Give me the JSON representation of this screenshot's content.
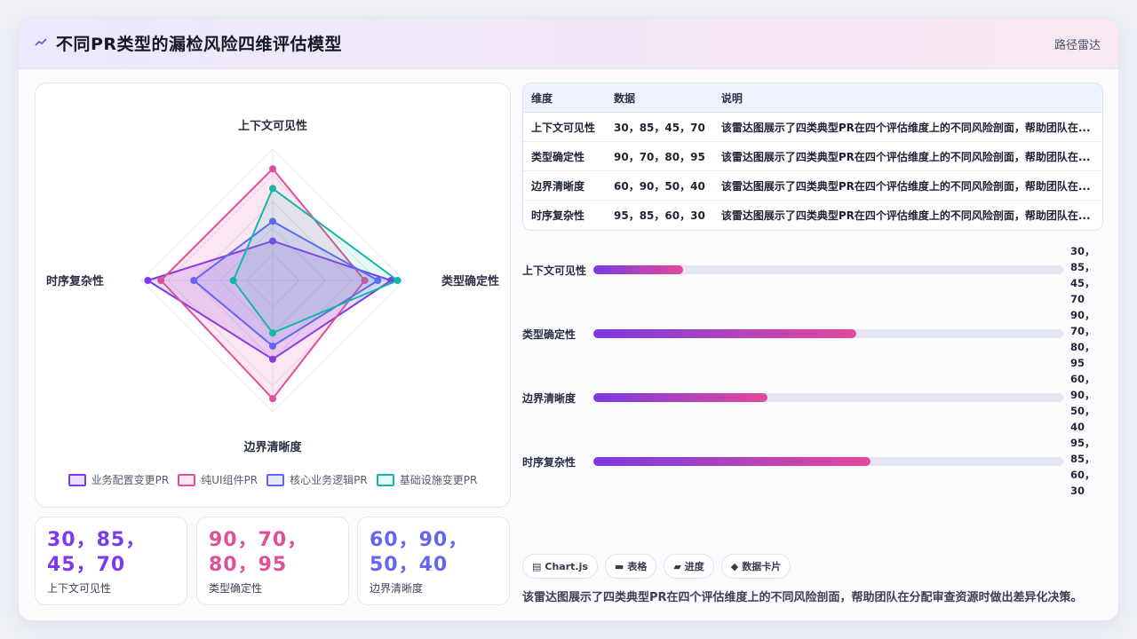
{
  "header": {
    "title": "不同PR类型的漏检风险四维评估模型",
    "tag": "路径雷达"
  },
  "colors": {
    "series_1": "#7c3aed",
    "series_2": "#e0509a",
    "series_3": "#6366f1",
    "series_4": "#14b8a6"
  },
  "chart_data": {
    "type": "radar",
    "axes": [
      "上下文可见性",
      "类型确定性",
      "边界清晰度",
      "时序复杂性"
    ],
    "range": [
      0,
      100
    ],
    "grid": true,
    "legend_position": "bottom",
    "series": [
      {
        "name": "业务配置变更PR",
        "values": [
          30,
          90,
          60,
          95
        ]
      },
      {
        "name": "纯UI组件PR",
        "values": [
          85,
          70,
          90,
          85
        ]
      },
      {
        "name": "核心业务逻辑PR",
        "values": [
          45,
          80,
          50,
          60
        ]
      },
      {
        "name": "基础设施变更PR",
        "values": [
          70,
          95,
          40,
          30
        ]
      }
    ]
  },
  "table": {
    "headers": [
      "维度",
      "数据",
      "说明"
    ],
    "rows": [
      {
        "dim": "上下文可见性",
        "data": "30，85，45，70",
        "desc": "该雷达图展示了四类典型PR在四个评估维度上的不同风险剖面，帮助团队在..."
      },
      {
        "dim": "类型确定性",
        "data": "90，70，80，95",
        "desc": "该雷达图展示了四类典型PR在四个评估维度上的不同风险剖面，帮助团队在..."
      },
      {
        "dim": "边界清晰度",
        "data": "60，90，50，40",
        "desc": "该雷达图展示了四类典型PR在四个评估维度上的不同风险剖面，帮助团队在..."
      },
      {
        "dim": "时序复杂性",
        "data": "95，85，60，30",
        "desc": "该雷达图展示了四类典型PR在四个评估维度上的不同风险剖面，帮助团队在..."
      }
    ]
  },
  "bars": [
    {
      "label": "上下文可见性",
      "value_text": "30，85，45，70",
      "progress": 0.19
    },
    {
      "label": "类型确定性",
      "value_text": "90，70，80，95",
      "progress": 0.56
    },
    {
      "label": "边界清晰度",
      "value_text": "60，90，50，40",
      "progress": 0.37
    },
    {
      "label": "时序复杂性",
      "value_text": "95，85，60，30",
      "progress": 0.59
    }
  ],
  "cards": [
    {
      "value": "30，85，45，70",
      "label": "上下文可见性"
    },
    {
      "value": "90，70，80，95",
      "label": "类型确定性"
    },
    {
      "value": "60，90，50，40",
      "label": "边界清晰度"
    }
  ],
  "chips": [
    {
      "icon": "chart-icon",
      "label": "Chart.js"
    },
    {
      "icon": "table-icon",
      "label": "表格"
    },
    {
      "icon": "progress-icon",
      "label": "进度"
    },
    {
      "icon": "card-icon",
      "label": "数据卡片"
    }
  ],
  "summary": "该雷达图展示了四类典型PR在四个评估维度上的不同风险剖面，帮助团队在分配审查资源时做出差异化决策。"
}
